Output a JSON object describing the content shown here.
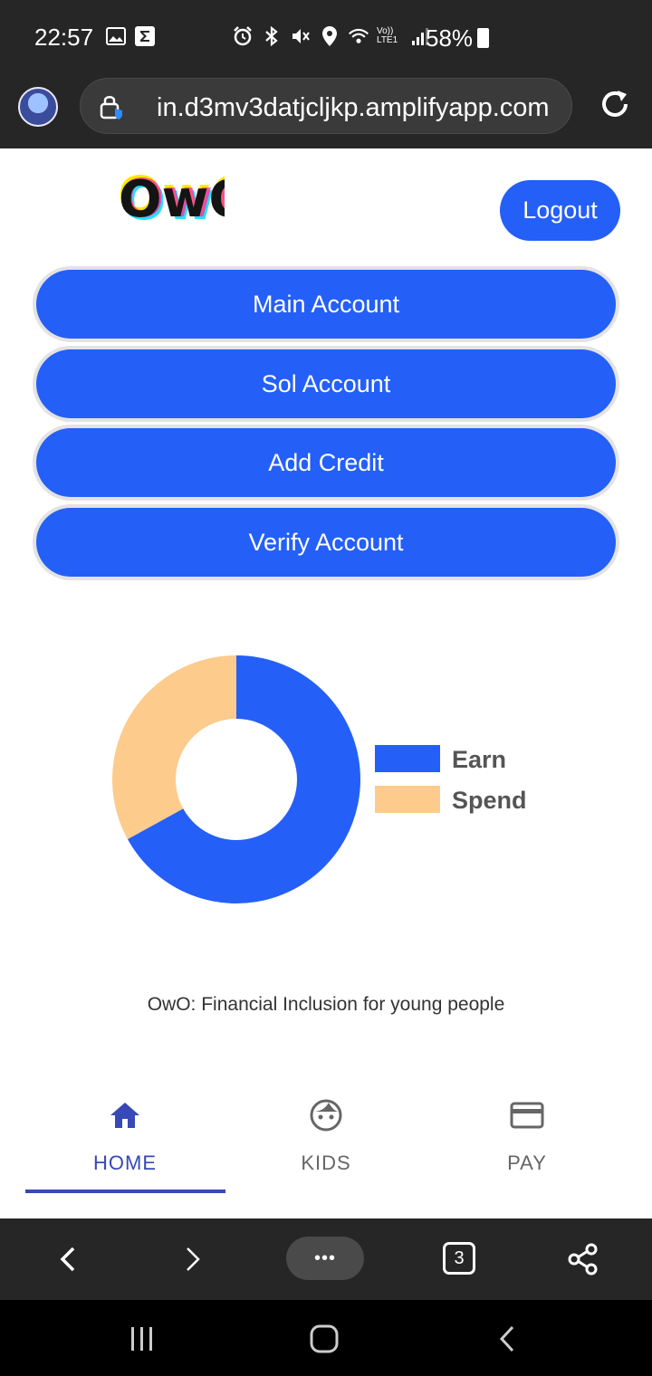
{
  "status_bar": {
    "time": "22:57",
    "battery_percent": "58%",
    "network_label": "Vo)) LTE1",
    "icons": [
      "gallery-icon",
      "sigma-icon",
      "alarm-icon",
      "bluetooth-icon",
      "mute-icon",
      "location-icon",
      "wifi-icon",
      "signal-icon",
      "battery-icon"
    ]
  },
  "browser": {
    "url": "in.d3mv3datjcljkp.amplifyapp.com",
    "tabs_count": "3",
    "more_label": "•••"
  },
  "header": {
    "logo_text": "OwO",
    "logout_label": "Logout"
  },
  "actions": [
    {
      "label": "Main Account"
    },
    {
      "label": "Sol Account"
    },
    {
      "label": "Add Credit"
    },
    {
      "label": "Verify Account"
    }
  ],
  "chart_data": {
    "type": "pie",
    "variant": "doughnut",
    "categories": [
      "Earn",
      "Spend"
    ],
    "values": [
      67,
      33
    ],
    "colors": [
      "#245ff7",
      "#fdcb8b"
    ],
    "legend_placement": "right",
    "title": ""
  },
  "tagline": "OwO: Financial Inclusion for young people",
  "bottom_tabs": [
    {
      "label": "HOME",
      "icon": "home-icon",
      "active": true,
      "color": "#3749b6"
    },
    {
      "label": "KIDS",
      "icon": "face-icon",
      "active": false,
      "color": "#666666"
    },
    {
      "label": "PAY",
      "icon": "credit-card-icon",
      "active": false,
      "color": "#666666"
    }
  ],
  "colors": {
    "accent": "#245ff7",
    "tab_active": "#3749b6",
    "system_bar": "#262626"
  }
}
